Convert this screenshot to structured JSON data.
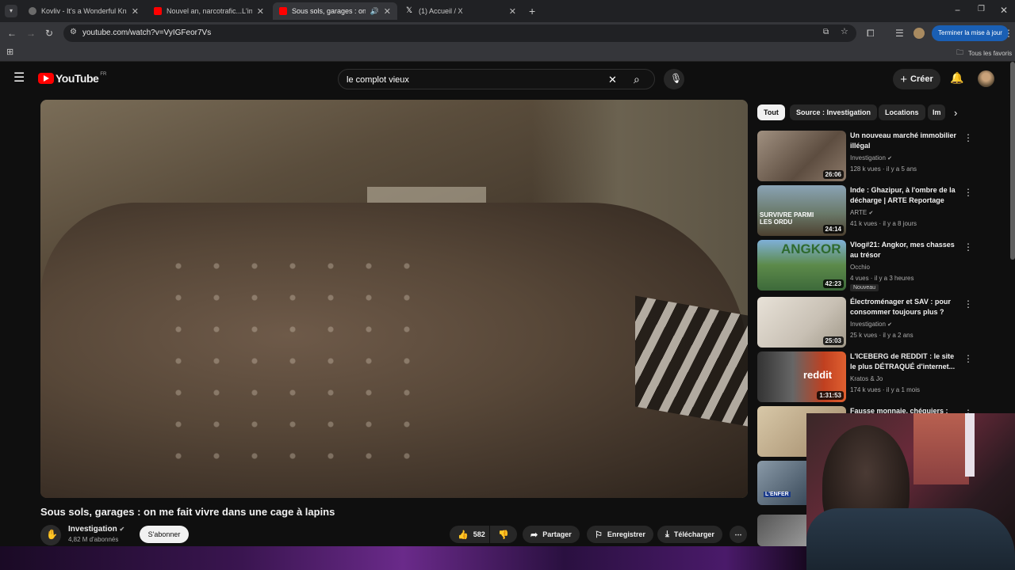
{
  "browser": {
    "tabs": [
      {
        "title": "Kovliv - It's a Wonderful Knife (",
        "active": false
      },
      {
        "title": "Nouvel an, narcotrafic...L'interv",
        "active": false
      },
      {
        "title": "Sous sols, garages : on me",
        "active": true
      },
      {
        "title": "(1) Accueil / X",
        "active": false
      }
    ],
    "url": "youtube.com/watch?v=VyIGFeor7Vs",
    "update_label": "Terminer la mise à jour",
    "bookmarks_label": "Tous les favoris"
  },
  "youtube": {
    "logo": "YouTube",
    "region": "FR",
    "search_query": "le complot vieux",
    "create_label": "Créer",
    "video": {
      "title": "Sous sols, garages : on me fait vivre dans une cage à lapins",
      "channel": "Investigation",
      "subscribers": "4,82 M d'abonnés",
      "subscribe_label": "S'abonner",
      "likes": "582",
      "share_label": "Partager",
      "save_label": "Enregistrer",
      "download_label": "Télécharger"
    },
    "chips": [
      "Tout",
      "Source : Investigation",
      "Locations",
      "Im"
    ],
    "recommendations": [
      {
        "title": "Un nouveau marché immobilier illégal",
        "channel": "Investigation",
        "meta": "128 k vues · il y a 5 ans",
        "duration": "26:06"
      },
      {
        "title": "Inde : Ghazipur, à l'ombre de la décharge | ARTE Reportage",
        "channel": "ARTE",
        "meta": "41 k vues · il y a 8 jours",
        "duration": "24:14",
        "thumb_text": "SURVIVRE PARMI LES ORDU"
      },
      {
        "title": "Vlog#21: Angkor, mes chasses au trésor",
        "channel": "Occhio",
        "meta": "4 vues · il y a 3 heures",
        "duration": "42:23",
        "badge": "Nouveau",
        "thumb_text": "ANGKOR"
      },
      {
        "title": "Électroménager et SAV : pour consommer toujours plus ?",
        "channel": "Investigation",
        "meta": "25 k vues · il y a 2 ans",
        "duration": "25:03"
      },
      {
        "title": "L'ICEBERG de REDDIT : le site le plus DÉTRAQUÉ d'internet...",
        "channel": "Kratos & Jo",
        "meta": "174 k vues · il y a 1 mois",
        "duration": "1:31:53",
        "thumb_text": "reddit"
      },
      {
        "title": "Fausse monnaie, chéquiers :",
        "channel": "",
        "meta": "",
        "duration": ""
      }
    ]
  },
  "icons": {
    "menu": "hamburger-icon",
    "search": "search-icon",
    "mic": "mic-icon",
    "notif": "bell-icon",
    "like": "thumbs-up-icon",
    "dislike": "thumbs-down-icon",
    "share": "share-icon",
    "save": "bookmark-icon",
    "download": "download-icon"
  },
  "colors": {
    "youtube_red": "#ff0000",
    "update_blue": "#1a5fb4",
    "background": "#0f0f0f"
  }
}
